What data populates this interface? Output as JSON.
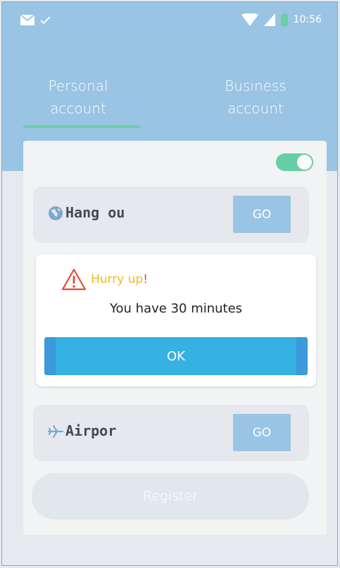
{
  "status_bar": {
    "time": "10:56",
    "icons": [
      "mail-icon",
      "check-icon",
      "wifi-icon",
      "signal-icon",
      "battery-icon"
    ]
  },
  "tabs": {
    "personal": {
      "line1": "Personal",
      "line2": "account",
      "selected": true
    },
    "business": {
      "line1": "Business",
      "line2": "account",
      "selected": false
    }
  },
  "card": {
    "toggle_on": true,
    "rows": [
      {
        "label": "Hang ou",
        "icon": "globe-icon",
        "button": "GO"
      },
      {
        "label": "Airpor",
        "icon": "airplane-icon",
        "button": "GO"
      }
    ],
    "register_label": "Register"
  },
  "dialog": {
    "icon": "warning-icon",
    "title": "Hurry up",
    "title_suffix": "!",
    "message": "You have 30 minutes",
    "ok_label": "OK"
  },
  "colors": {
    "header": "#99c4e3",
    "accent_green": "#67cfa5",
    "ok_button": "#35b1e2",
    "warning_title": "#f0bc1e",
    "warning_icon": "#e64a3c"
  }
}
